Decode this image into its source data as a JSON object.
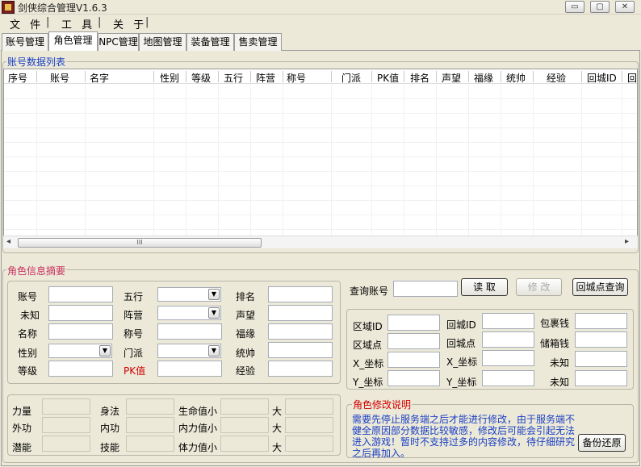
{
  "window": {
    "title": "剑侠综合管理V1.6.3",
    "min": "▭",
    "max": "▢",
    "close": "✕"
  },
  "menu": [
    "文 件",
    "工 具",
    "关 于"
  ],
  "menu_sep": "|",
  "tabs": [
    "账号管理",
    "角色管理",
    "NPC管理",
    "地图管理",
    "装备管理",
    "售卖管理"
  ],
  "active_tab": "角色管理",
  "list": {
    "title": "账号数据列表",
    "columns": [
      "序号",
      "账号",
      "名字",
      "性别",
      "等级",
      "五行",
      "阵营",
      "称号",
      "门派",
      "PK值",
      "排名",
      "声望",
      "福缘",
      "统帅",
      "经验",
      "回城ID",
      "回"
    ],
    "rows": [],
    "scroll_left": "◂",
    "scroll_right": "▸",
    "scroll_grip": "III"
  },
  "summary": {
    "title": "角色信息摘要",
    "col1": [
      "账号",
      "未知",
      "名称",
      "性别",
      "等级"
    ],
    "col2": [
      "五行",
      "阵营",
      "称号",
      "门派",
      "PK值"
    ],
    "col3": [
      "排名",
      "声望",
      "福缘",
      "统帅",
      "经验"
    ]
  },
  "query": {
    "label": "查询账号",
    "read_button": "读 取",
    "modify_button": "修 改",
    "city_query_button": "回城点查询"
  },
  "locations": {
    "col1": [
      "区域ID",
      "区域点",
      "X_坐标",
      "Y_坐标"
    ],
    "col2": [
      "回城ID",
      "回城点",
      "X_坐标",
      "Y_坐标"
    ],
    "col3": [
      "包裹钱",
      "储箱钱",
      "未知",
      "未知"
    ]
  },
  "stats": {
    "col1": [
      "力量",
      "外功",
      "潜能"
    ],
    "col2": [
      "身法",
      "内功",
      "技能"
    ],
    "col3": [
      "生命值小",
      "内力值小",
      "体力值小"
    ],
    "col4": [
      "大",
      "大",
      "大"
    ]
  },
  "notes": {
    "title": "角色修改说明",
    "text": "需要先停止服务端之后才能进行修改，由于服务端不健全原因部分数据比较敏感，修改后可能会引起无法进入游戏！暂时不支持过多的内容修改，待仔细研究之后再加入。",
    "backup_button": "备份还原"
  },
  "colors": {
    "accent_blue": "#1a3fc4",
    "group_title_pink": "#c8305f",
    "pk_red": "#d00000"
  }
}
